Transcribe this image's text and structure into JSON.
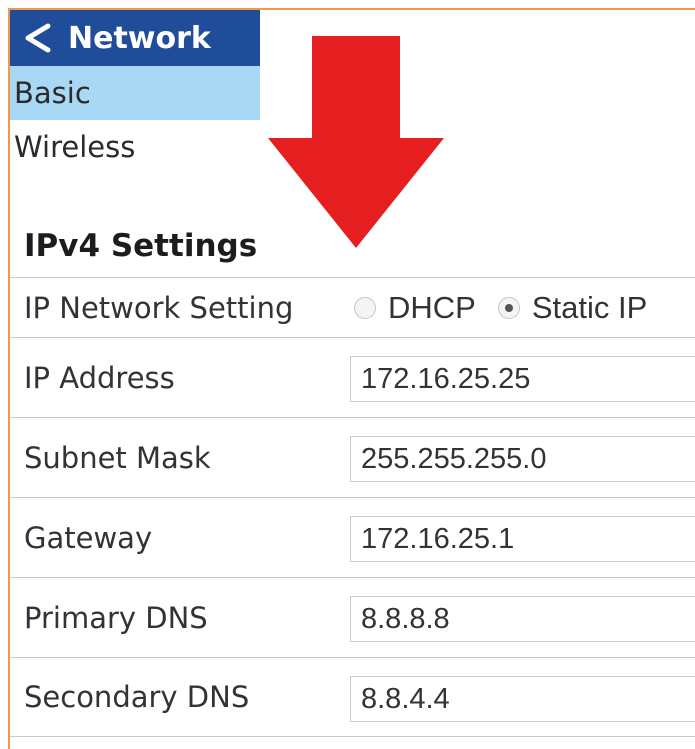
{
  "nav": {
    "title": "Network",
    "back_icon": "chevron-left-icon",
    "items": [
      {
        "label": "Basic",
        "selected": true
      },
      {
        "label": "Wireless",
        "selected": false
      }
    ]
  },
  "annotation": {
    "icon": "down-arrow-icon",
    "color": "#e51f1f"
  },
  "section": {
    "title": "IPv4 Settings"
  },
  "ip_network_setting": {
    "label": "IP Network Setting",
    "options": [
      {
        "label": "DHCP",
        "selected": false
      },
      {
        "label": "Static IP",
        "selected": true
      }
    ]
  },
  "fields": [
    {
      "label": "IP Address",
      "value": "172.16.25.25"
    },
    {
      "label": "Subnet Mask",
      "value": "255.255.255.0"
    },
    {
      "label": "Gateway",
      "value": "172.16.25.1"
    },
    {
      "label": "Primary DNS",
      "value": "8.8.8.8"
    },
    {
      "label": "Secondary DNS",
      "value": "8.8.4.4"
    }
  ],
  "colors": {
    "nav_header_bg": "#1f4d9a",
    "nav_selected_bg": "#a9d8f5",
    "frame_border": "#ee9a4a",
    "arrow": "#e51f1f"
  }
}
